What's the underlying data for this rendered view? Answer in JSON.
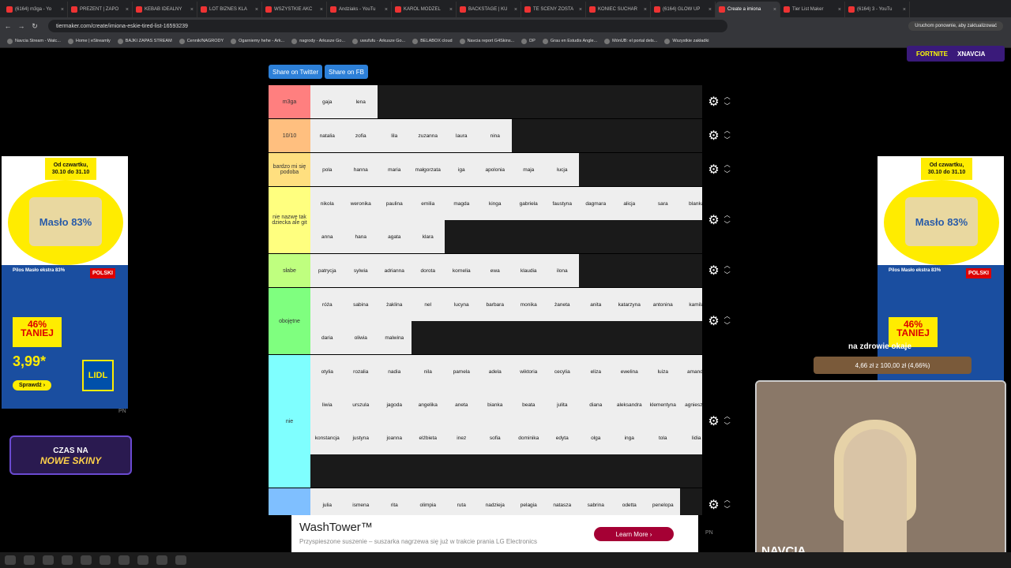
{
  "browser": {
    "tabs": [
      {
        "label": "(6164) m3ga - Yo",
        "active": false
      },
      {
        "label": "PREZENT | ZAPO",
        "active": false
      },
      {
        "label": "KEBAB IDEALNY",
        "active": false
      },
      {
        "label": "LOT BIZNES KLA",
        "active": false
      },
      {
        "label": "WSZYSTKIE AKC",
        "active": false
      },
      {
        "label": "Andziaks - YouTu",
        "active": false
      },
      {
        "label": "KAROL MODZEL",
        "active": false
      },
      {
        "label": "BACKSTAGE | KU",
        "active": false
      },
      {
        "label": "TE SCENY ZOSTA",
        "active": false
      },
      {
        "label": "KONIEC SUCHAR",
        "active": false
      },
      {
        "label": "(6164) GLOW UP",
        "active": false
      },
      {
        "label": "Create a imiona",
        "active": true
      },
      {
        "label": "Tier List Maker",
        "active": false
      },
      {
        "label": "(6164) 3 - YouTu",
        "active": false
      }
    ],
    "url": "tiermaker.com/create/imiona-eskie-tired-list-16593239",
    "update_label": "Uruchom ponownie, aby zaktualizować",
    "bookmarks": [
      "Navcia Stream - Watc...",
      "Home | eStreamly",
      "BAJKI ZAPAS STREAM",
      "Cennik/NAGRODY",
      "Ogarniemy hehe - Ark...",
      "nagrody - Arkusze Go...",
      "uwufufu - Arkusze Go...",
      "BELABOX cloud",
      "Navcia report G4Skins...",
      "DP",
      "Grau en Estudis Angle...",
      "MónUB: el portal dels...",
      "Wszystkie zakładki"
    ]
  },
  "banner": {
    "brand": "FORTNITE",
    "partner": "XNAVCIA"
  },
  "share": {
    "twitter": "Share on Twitter",
    "fb": "Share on FB"
  },
  "tiers": [
    {
      "label": "m3ga",
      "color": "#ff7f7f",
      "items": [
        "gaja",
        "lena"
      ]
    },
    {
      "label": "10/10",
      "color": "#ffbf7f",
      "items": [
        "natalia",
        "zofia",
        "lila",
        "zuzanna",
        "laura",
        "nina"
      ]
    },
    {
      "label": "bardzo mi się podoba",
      "color": "#ffdf7f",
      "items": [
        "pola",
        "hanna",
        "maria",
        "małgorzata",
        "iga",
        "apolonia",
        "maja",
        "łucja"
      ]
    },
    {
      "label": "nie nazwę tak dziecka ale git",
      "color": "#ffff7f",
      "items": [
        "nikola",
        "weronika",
        "paulina",
        "emilia",
        "magda",
        "kinga",
        "gabriela",
        "faustyna",
        "dagmara",
        "alicja",
        "sara",
        "blanka",
        "anna",
        "hana",
        "agata",
        "klara"
      ]
    },
    {
      "label": "słabe",
      "color": "#bfff7f",
      "items": [
        "patrycja",
        "sylwia",
        "adrianna",
        "dorota",
        "kornelia",
        "ewa",
        "klaudia",
        "ilona"
      ]
    },
    {
      "label": "obojętne",
      "color": "#7fff7f",
      "items": [
        "róża",
        "sabina",
        "żaklina",
        "nel",
        "lucyna",
        "barbara",
        "monika",
        "żaneta",
        "anita",
        "katarzyna",
        "antonina",
        "kamila",
        "daria",
        "oliwia",
        "malwina"
      ]
    },
    {
      "label": "nie",
      "color": "#7fffff",
      "items": [
        "otylia",
        "rozalia",
        "nadia",
        "nila",
        "pamela",
        "adela",
        "wiktoria",
        "cecylia",
        "eliza",
        "ewelina",
        "luiza",
        "amanda",
        "liwia",
        "urszula",
        "jagoda",
        "angelika",
        "aneta",
        "bianka",
        "beata",
        "julita",
        "diana",
        "aleksandra",
        "klementyna",
        "agnieszka",
        "konstancja",
        "justyna",
        "joanna",
        "elżbieta",
        "inez",
        "sofia",
        "dominika",
        "edyta",
        "olga",
        "inga",
        "tola",
        "lidia"
      ]
    },
    {
      "label": "",
      "color": "#7fbfff",
      "items": [
        "julia",
        "ismena",
        "rita",
        "olimpia",
        "ruta",
        "nadzieja",
        "pelagia",
        "natasza",
        "sabrina",
        "odetta",
        "penelopa"
      ]
    }
  ],
  "side_ad": {
    "date_line1": "Od czwartku,",
    "date_line2": "30.10 do 31.10",
    "product": "Masło 83%",
    "pilos": "Pilos Masło ekstra 83%",
    "polski": "POLSKI",
    "taniej": "46% TANIEJ",
    "price": "3,99*",
    "button": "Sprawdź ›",
    "brand": "LIDL"
  },
  "skiny": {
    "line1": "CZAS NA",
    "line2": "NOWE SKINY"
  },
  "pn_label": "PN",
  "bottom_ad": {
    "title": "WashTower™",
    "subtitle": "Przyspieszone suszenie – suszarka nagrzewa się już w trakcie prania LG Electronics",
    "button": "Learn More ›"
  },
  "stream": {
    "donation": "na zdrowie okaje",
    "goal": "4,66 zł z 100,00 zł (4,66%)",
    "name": "NAVCIA"
  }
}
